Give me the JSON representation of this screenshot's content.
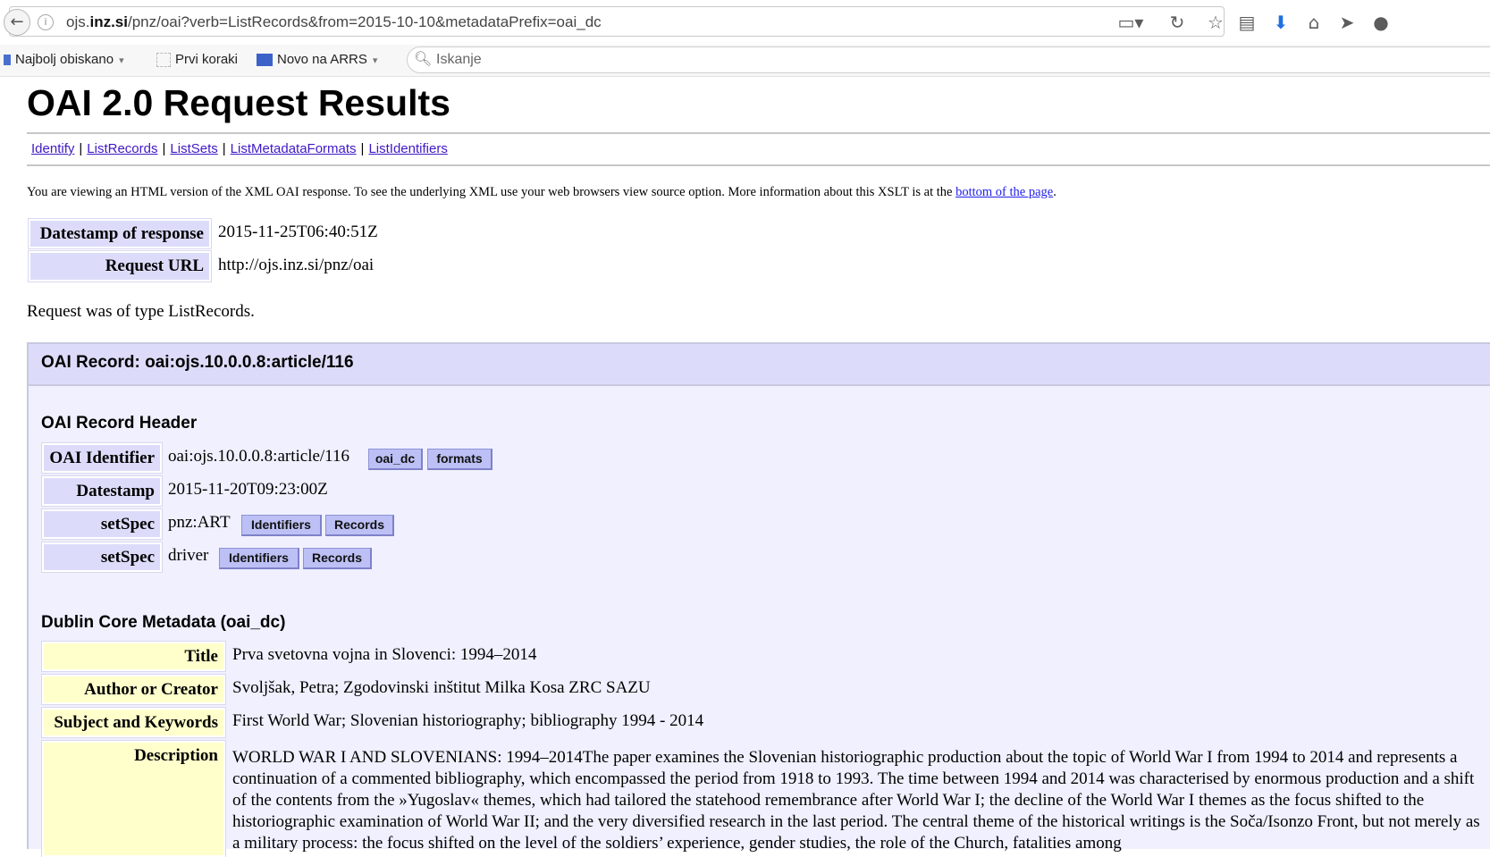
{
  "browser": {
    "url": {
      "prefix": "ojs.",
      "host": "inz.si",
      "path": "/pnz/oai?verb=ListRecords&from=2015-10-10&metadataPrefix=oai_dc"
    },
    "bookmarks": [
      {
        "label": "Najbolj obiskano",
        "has_dropdown": true
      },
      {
        "label": "Prvi koraki",
        "has_dropdown": false
      },
      {
        "label": "Novo na ARRS",
        "has_dropdown": true
      }
    ],
    "search_placeholder": "Iskanje",
    "toolbar_icons": [
      "reader-view-icon",
      "reload-icon",
      "bookmark-star-icon",
      "reading-list-icon",
      "download-icon",
      "home-icon",
      "send-icon",
      "chat-icon"
    ]
  },
  "page": {
    "title": "OAI 2.0 Request Results",
    "nav_links": [
      "Identify",
      "ListRecords",
      "ListSets",
      "ListMetadataFormats",
      "ListIdentifiers"
    ],
    "notice_text": "You are viewing an HTML version of the XML OAI response. To see the underlying XML use your web browsers view source option. More information about this XSLT is at the ",
    "notice_link": "bottom of the page",
    "notice_end": ".",
    "response": [
      {
        "label": "Datestamp of response",
        "value": "2015-11-25T06:40:51Z"
      },
      {
        "label": "Request URL",
        "value": "http://ojs.inz.si/pnz/oai"
      }
    ],
    "request_type": "Request was of type ListRecords.",
    "record": {
      "title": "OAI Record: oai:ojs.10.0.0.8:article/116",
      "header_heading": "OAI Record Header",
      "header_rows": [
        {
          "label": "OAI Identifier",
          "value": "oai:ojs.10.0.0.8:article/116",
          "buttons": [
            "oai_dc",
            "formats"
          ]
        },
        {
          "label": "Datestamp",
          "value": "2015-11-20T09:23:00Z",
          "buttons": []
        },
        {
          "label": "setSpec",
          "value": "pnz:ART",
          "buttons": [
            "Identifiers",
            "Records"
          ]
        },
        {
          "label": "setSpec",
          "value": "driver",
          "buttons": [
            "Identifiers",
            "Records"
          ]
        }
      ],
      "dc_heading": "Dublin Core Metadata (oai_dc)",
      "dc_rows": [
        {
          "label": "Title",
          "value": "Prva svetovna vojna in Slovenci: 1994–2014"
        },
        {
          "label": "Author or Creator",
          "value": "Svoljšak, Petra; Zgodovinski inštitut Milka Kosa ZRC SAZU"
        },
        {
          "label": "Subject and Keywords",
          "value": "First World War; Slovenian historiography; bibliography 1994 - 2014"
        },
        {
          "label": "Description",
          "value": "WORLD WAR I AND SLOVENIANS: 1994–2014The paper examines the Slovenian historiographic production about the topic of World War I from 1994 to 2014 and represents a continuation of a commented bibliography, which encompassed the period from 1918 to 1993. The time between 1994 and 2014 was characterised by enormous production and a shift of the contents from the »Yugoslav« themes, which had tailored the statehood remembrance after World War I; the decline of the World War I themes as the focus shifted to the historiographic examination of World War II; and the very diversified research in the last period. The central theme of the historical writings is the Soča/Isonzo Front, but not merely as a military process: the focus shifted on the level of the soldiers’ experience, gender studies, the role of the Church, fatalities among"
        }
      ]
    }
  }
}
